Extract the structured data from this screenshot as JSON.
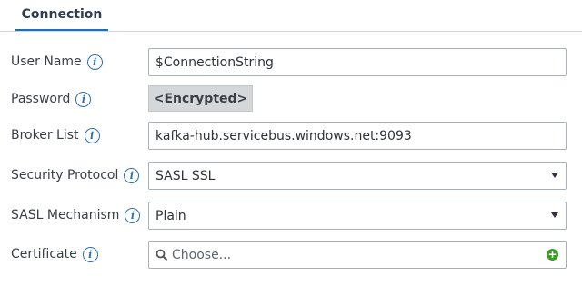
{
  "tabs": [
    {
      "label": "Connection",
      "active": true
    }
  ],
  "accent_color": "#1f6fb2",
  "info_icon": "info-circle-icon",
  "fields": {
    "user_name": {
      "label": "User Name",
      "value": "$ConnectionString"
    },
    "password": {
      "label": "Password",
      "value": "<Encrypted>"
    },
    "broker_list": {
      "label": "Broker List",
      "value": "kafka-hub.servicebus.windows.net:9093"
    },
    "security_protocol": {
      "label": "Security Protocol",
      "value": "SASL SSL"
    },
    "sasl_mechanism": {
      "label": "SASL Mechanism",
      "value": "Plain"
    },
    "certificate": {
      "label": "Certificate",
      "placeholder": "Choose..."
    }
  }
}
